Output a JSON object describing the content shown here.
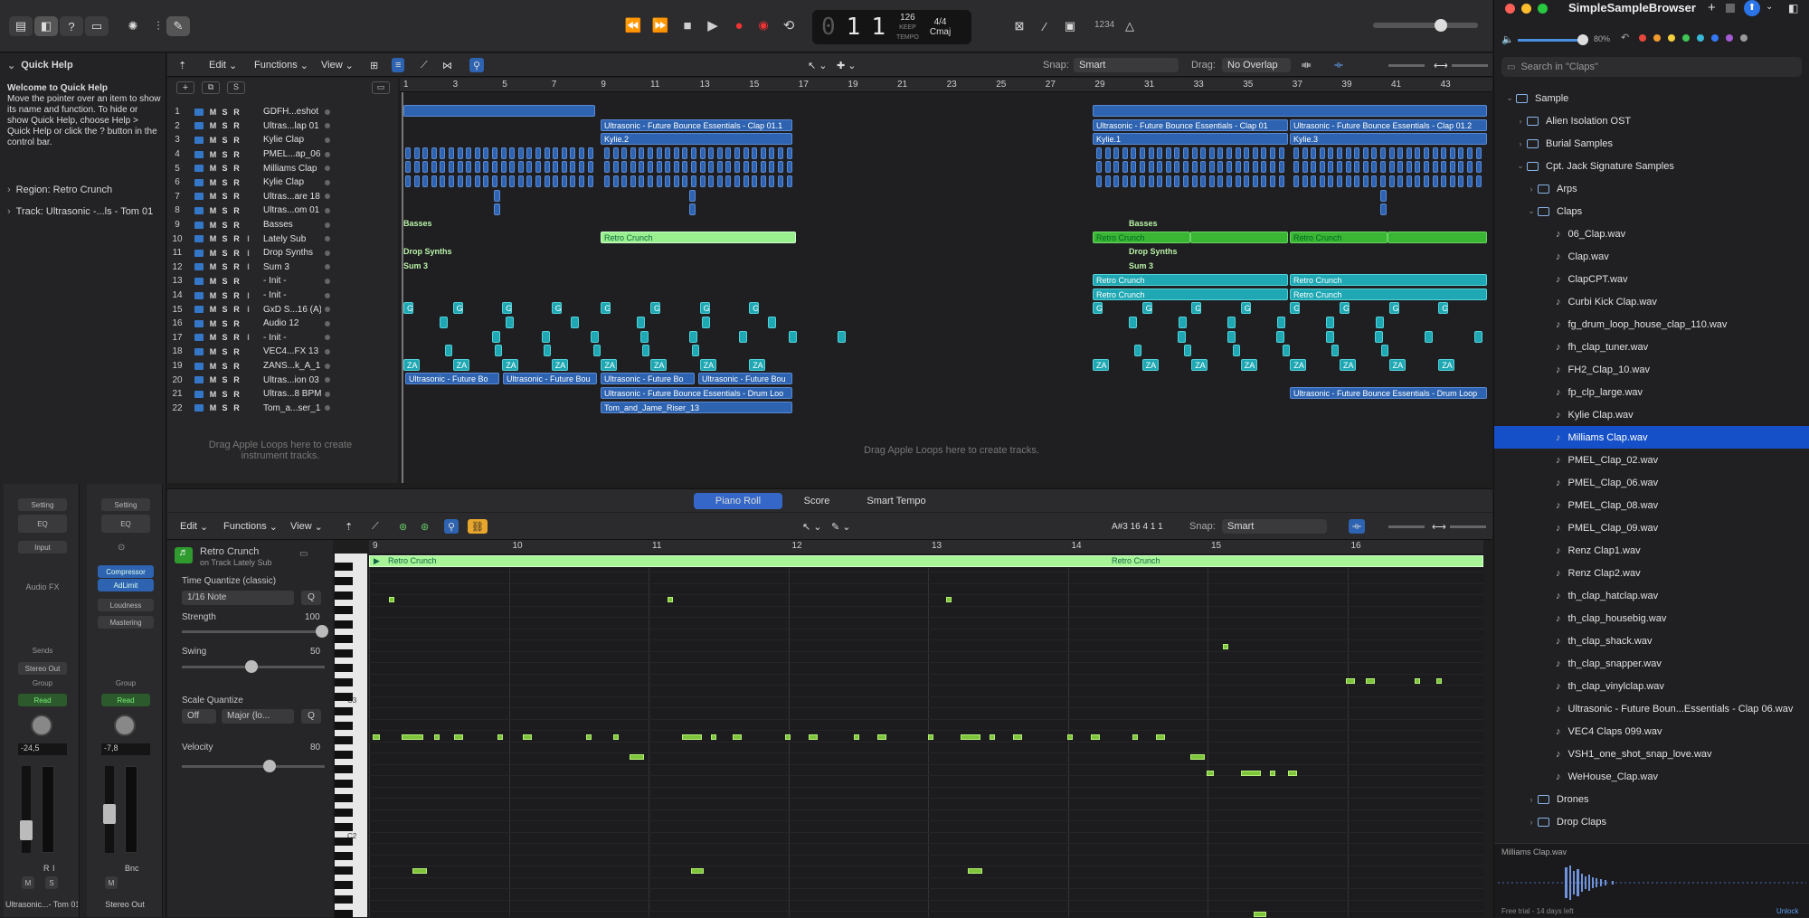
{
  "toolbar": {
    "lcd_bar": "1",
    "lcd_beat": "1",
    "bar_label": "BAR",
    "beat_label": "BEAT",
    "tempo": "126",
    "tempo_mode": "KEEP",
    "tempo_label": "TEMPO",
    "signature": "4/4",
    "key": "Cmaj",
    "cpu_label": "1234"
  },
  "inspector": {
    "quick_help_title": "Quick Help",
    "quick_help_heading": "Welcome to Quick Help",
    "quick_help_body": "Move the pointer over an item to show its name and function. To hide or show Quick Help, choose Help > Quick Help or click the ? button in the control bar.",
    "region_label": "Region: Retro Crunch",
    "track_label": "Track: Ultrasonic -...ls - Tom 01",
    "strip1": {
      "setting": "Setting",
      "eq": "EQ",
      "input": "Input",
      "audio_fx": "Audio FX",
      "sends": "Sends",
      "output": "Stereo Out",
      "group": "Group",
      "automation": "Read",
      "pan_value": "-24,5",
      "name": "Ultrasonic...- Tom 01",
      "m": "M",
      "s": "S",
      "r": "R",
      "i": "I"
    },
    "strip2": {
      "setting": "Setting",
      "eq": "EQ",
      "fx1": "Compressor",
      "fx2": "AdLimit",
      "fx3": "Loudness",
      "fx4": "Mastering",
      "group": "Group",
      "automation": "Read",
      "pan_value": "-7,8",
      "name": "Stereo Out",
      "m": "M",
      "bnc": "Bnc"
    }
  },
  "tracks_menu": {
    "edit": "Edit",
    "functions": "Functions",
    "view": "View",
    "snap_label": "Snap:",
    "snap_value": "Smart",
    "drag_label": "Drag:",
    "drag_value": "No Overlap"
  },
  "tracks": [
    {
      "num": "1",
      "name": "GDFH...eshot"
    },
    {
      "num": "2",
      "name": "Ultras...lap 01"
    },
    {
      "num": "3",
      "name": "Kylie Clap"
    },
    {
      "num": "4",
      "name": "PMEL...ap_06"
    },
    {
      "num": "5",
      "name": "Milliams Clap"
    },
    {
      "num": "6",
      "name": "Kylie Clap"
    },
    {
      "num": "7",
      "name": "Ultras...are 18"
    },
    {
      "num": "8",
      "name": "Ultras...om 01"
    },
    {
      "num": "9",
      "name": "Basses"
    },
    {
      "num": "10",
      "name": "Lately Sub"
    },
    {
      "num": "11",
      "name": "Drop Synths"
    },
    {
      "num": "12",
      "name": "Sum 3"
    },
    {
      "num": "13",
      "name": "- Init -"
    },
    {
      "num": "14",
      "name": "- Init -"
    },
    {
      "num": "15",
      "name": "GxD S...16 (A)"
    },
    {
      "num": "16",
      "name": "Audio 12"
    },
    {
      "num": "17",
      "name": "- Init -"
    },
    {
      "num": "18",
      "name": "VEC4...FX 13"
    },
    {
      "num": "19",
      "name": "ZANS...k_A_1"
    },
    {
      "num": "20",
      "name": "Ultras...ion 03"
    },
    {
      "num": "21",
      "name": "Ultras...8 BPM"
    },
    {
      "num": "22",
      "name": "Tom_a...ser_13"
    }
  ],
  "track_btn": {
    "m": "M",
    "s": "S",
    "r": "R",
    "i": "I"
  },
  "drag_hint_left": "Drag Apple Loops here to create instrument tracks.",
  "drag_hint_right": "Drag Apple Loops here to create tracks.",
  "ruler": [
    "1",
    "3",
    "5",
    "7",
    "9",
    "11",
    "13",
    "15",
    "17",
    "19",
    "21",
    "23",
    "25",
    "27",
    "29",
    "31",
    "33",
    "35",
    "37",
    "39",
    "41",
    "43"
  ],
  "regions": {
    "clap01a": "Ultrasonic - Future Bounce Essentials - Clap 01.1",
    "clap01b": "Ultrasonic - Future Bounce Essentials - Clap 01",
    "clap01c": "Ultrasonic - Future Bounce Essentials - Clap 01.2",
    "kylie2": "Kylie.2",
    "kylie1": "Kylie.1",
    "kylie3": "Kylie.3",
    "basses": "Basses",
    "retro": "Retro Crunch",
    "drop": "Drop Synths",
    "sum3": "Sum 3",
    "g": "G",
    "za": "ZA",
    "futurebo": "Ultrasonic - Future Bo",
    "futurebou": "Ultrasonic - Future Bou",
    "drumloo": "Ultrasonic - Future Bounce Essentials - Drum Loo",
    "drumloop": "Ultrasonic - Future Bounce Essentials - Drum Loop",
    "tomriser": "Tom_and_Jame_Riser_13"
  },
  "piano_roll": {
    "tabs": [
      "Piano Roll",
      "Score",
      "Smart Tempo"
    ],
    "edit": "Edit",
    "functions": "Functions",
    "view": "View",
    "position": "A#3  16 4 1 1",
    "snap_label": "Snap:",
    "snap_value": "Smart",
    "region_name": "Retro Crunch",
    "region_track": "on Track Lately Sub",
    "time_quantize": "Time Quantize (classic)",
    "quantize_value": "1/16 Note",
    "q": "Q",
    "strength_label": "Strength",
    "strength_value": "100",
    "swing_label": "Swing",
    "swing_value": "50",
    "scale_quantize": "Scale Quantize",
    "scale_off": "Off",
    "scale_mode": "Major (lo...",
    "velocity_label": "Velocity",
    "velocity_value": "80",
    "ruler": [
      "9",
      "10",
      "11",
      "12",
      "13",
      "14",
      "15",
      "16"
    ],
    "c3": "C3",
    "c2": "C2"
  },
  "browser": {
    "title": "SimpleSampleBrowser",
    "volume": "80%",
    "search_placeholder": "Search in \"Claps\"",
    "root": "Sample",
    "folders_top": [
      "Alien Isolation OST",
      "Burial Samples",
      "Cpt. Jack Signature Samples"
    ],
    "sub": [
      "Arps",
      "Claps"
    ],
    "files": [
      "06_Clap.wav",
      "Clap.wav",
      "ClapCPT.wav",
      "Curbi Kick Clap.wav",
      "fg_drum_loop_house_clap_110.wav",
      "fh_clap_tuner.wav",
      "FH2_Clap_10.wav",
      "fp_clp_large.wav",
      "Kylie Clap.wav",
      "Milliams Clap.wav",
      "PMEL_Clap_02.wav",
      "PMEL_Clap_06.wav",
      "PMEL_Clap_08.wav",
      "PMEL_Clap_09.wav",
      "Renz Clap1.wav",
      "Renz Clap2.wav",
      "th_clap_hatclap.wav",
      "th_clap_housebig.wav",
      "th_clap_shack.wav",
      "th_clap_snapper.wav",
      "th_clap_vinylclap.wav",
      "Ultrasonic - Future Boun...Essentials - Clap 06.wav",
      "VEC4 Claps 099.wav",
      "VSH1_one_shot_snap_love.wav",
      "WeHouse_Clap.wav"
    ],
    "selected_index": 9,
    "folders_bottom": [
      "Drones",
      "Drop Claps"
    ],
    "preview_name": "Milliams Clap.wav",
    "trial": "Free trial - 14 days left",
    "unlock": "Unlock",
    "colors": [
      "#e8473e",
      "#f29a2e",
      "#f4d03f",
      "#3fc655",
      "#37b8d6",
      "#3478f6",
      "#a45bd6",
      "#9a9a9a"
    ]
  }
}
